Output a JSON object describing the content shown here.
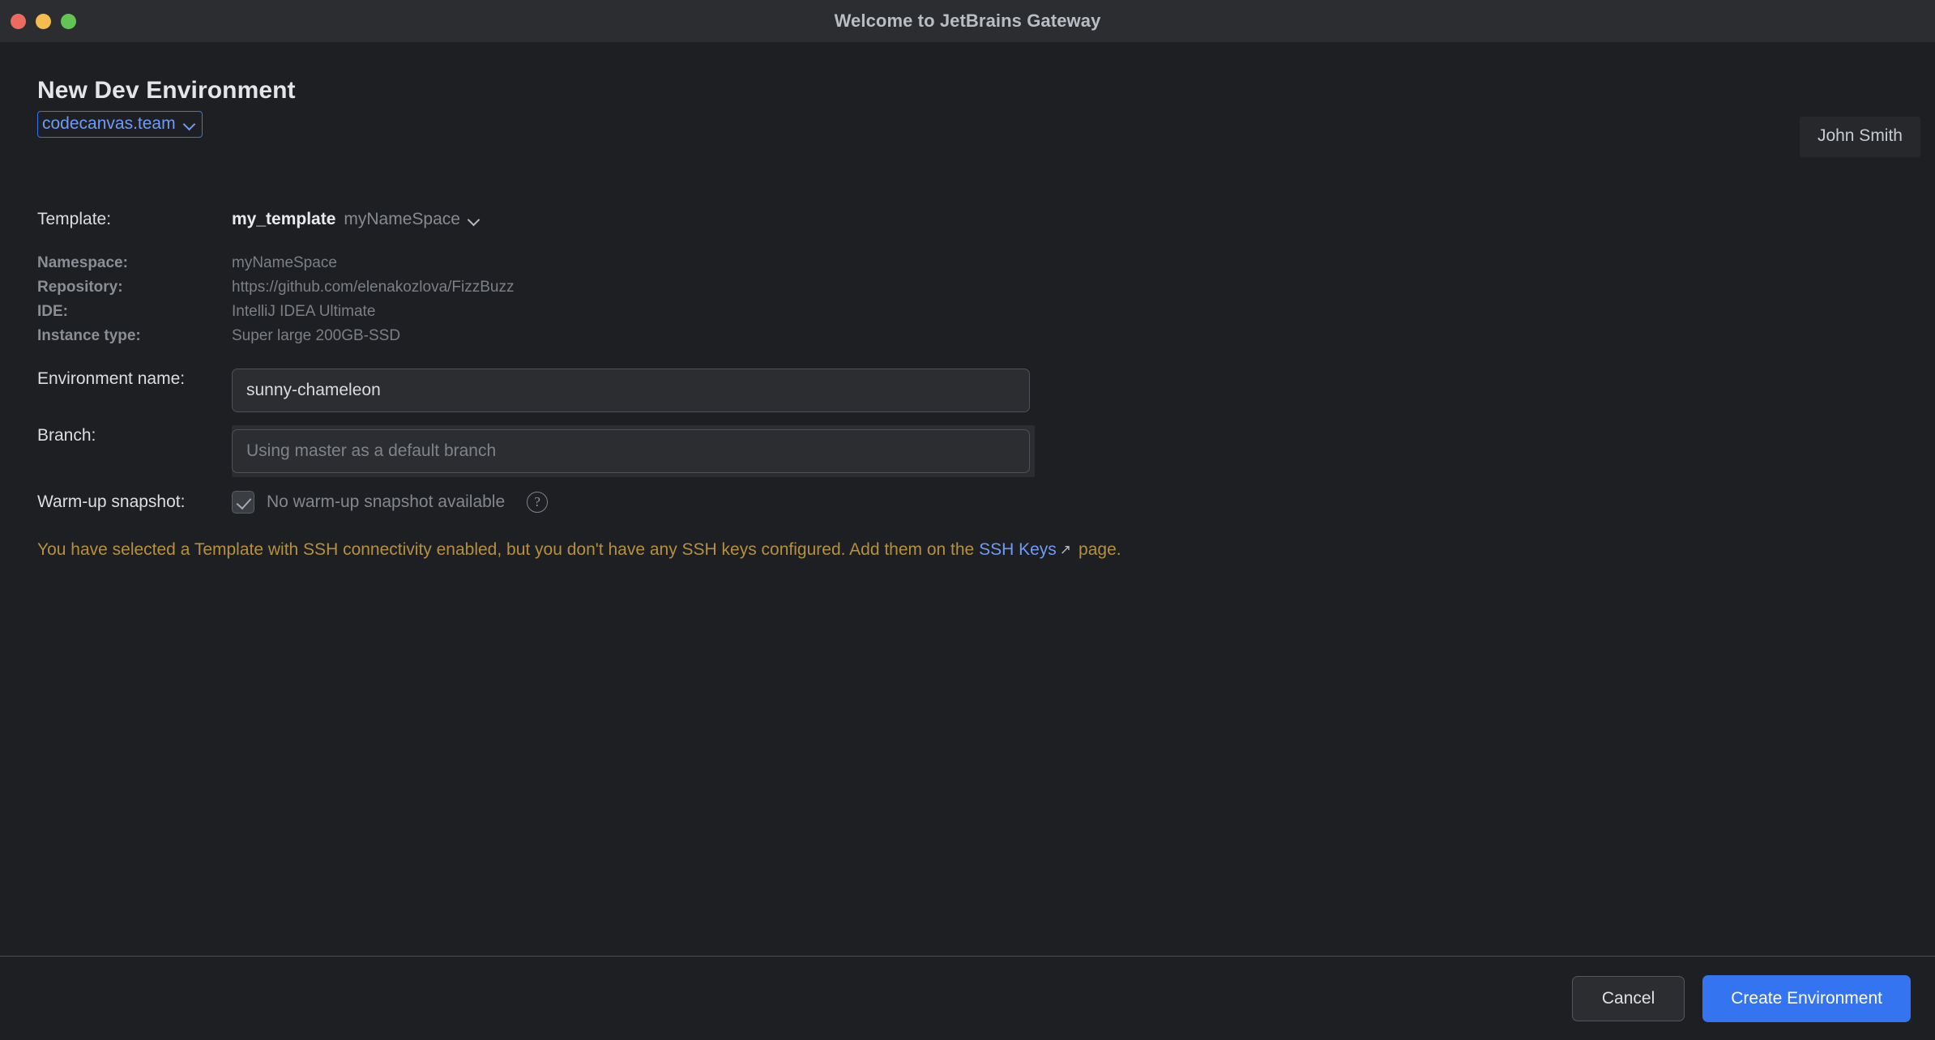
{
  "window": {
    "title": "Welcome to JetBrains Gateway",
    "traffic_lights": [
      {
        "name": "close",
        "color": "#ec6a5f"
      },
      {
        "name": "minimize",
        "color": "#f4bd4f"
      },
      {
        "name": "zoom",
        "color": "#61c554"
      }
    ]
  },
  "header": {
    "page_title": "New Dev Environment",
    "org_selector": {
      "value": "codecanvas.team",
      "chevron": "chevron-down-icon",
      "focus_color": "#3574f0"
    },
    "user": "John Smith"
  },
  "form": {
    "template": {
      "label": "Template:",
      "name": "my_template",
      "namespace": "myNameSpace",
      "chevron": "chevron-down-icon"
    },
    "details": [
      {
        "key": "Namespace:",
        "value": "myNameSpace"
      },
      {
        "key": "Repository:",
        "value": "https://github.com/elenakozlova/FizzBuzz"
      },
      {
        "key": "IDE:",
        "value": "IntelliJ IDEA Ultimate"
      },
      {
        "key": "Instance type:",
        "value": "Super large 200GB-SSD"
      }
    ],
    "environment_name": {
      "label": "Environment name:",
      "value": "sunny-chameleon",
      "placeholder": ""
    },
    "branch": {
      "label": "Branch:",
      "value": "",
      "placeholder": "Using master as a default branch"
    },
    "warmup": {
      "label": "Warm-up snapshot:",
      "checkbox_checked": true,
      "text": "No warm-up snapshot available",
      "help_icon": "?"
    }
  },
  "warning": {
    "text_before": "You have selected a Template with SSH connectivity enabled, but you don't have any SSH keys configured. Add them on the ",
    "link_text": "SSH Keys",
    "link_icon": "↗",
    "text_after": "page.",
    "color": "#b5903f",
    "link_color": "#6f9bf8"
  },
  "footer": {
    "cancel_label": "Cancel",
    "create_label": "Create Environment",
    "primary_color": "#3574f0"
  }
}
